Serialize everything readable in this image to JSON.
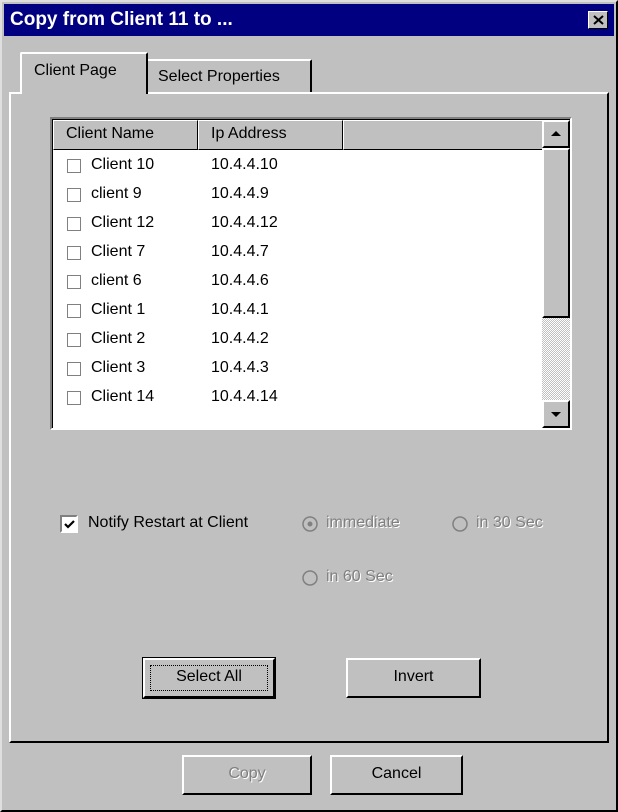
{
  "window": {
    "title": "Copy from Client 11 to ..."
  },
  "tabs": [
    {
      "label": "Client Page",
      "active": true
    },
    {
      "label": "Select Properties",
      "active": false
    }
  ],
  "client_list": {
    "columns": [
      "Client Name",
      "Ip Address",
      ""
    ],
    "rows": [
      {
        "name": "Client 10",
        "ip": "10.4.4.10",
        "checked": false
      },
      {
        "name": "client 9",
        "ip": "10.4.4.9",
        "checked": false
      },
      {
        "name": "Client 12",
        "ip": "10.4.4.12",
        "checked": false
      },
      {
        "name": "Client 7",
        "ip": "10.4.4.7",
        "checked": false
      },
      {
        "name": "client 6",
        "ip": "10.4.4.6",
        "checked": false
      },
      {
        "name": "Client 1",
        "ip": "10.4.4.1",
        "checked": false
      },
      {
        "name": "Client 2",
        "ip": "10.4.4.2",
        "checked": false
      },
      {
        "name": "Client 3",
        "ip": "10.4.4.3",
        "checked": false
      },
      {
        "name": "Client 14",
        "ip": "10.4.4.14",
        "checked": false
      }
    ]
  },
  "notify": {
    "label": "Notify Restart at Client",
    "checked": true,
    "options": [
      {
        "label": "immediate",
        "selected": true,
        "enabled": false
      },
      {
        "label": "in 30 Sec",
        "selected": false,
        "enabled": false
      },
      {
        "label": "in 60 Sec",
        "selected": false,
        "enabled": false
      }
    ]
  },
  "buttons": {
    "select_all": "Select All",
    "invert": "Invert",
    "copy": "Copy",
    "cancel": "Cancel"
  },
  "colors": {
    "title_bar": "#000080",
    "face": "#c0c0c0",
    "disabled_text": "#808080"
  }
}
